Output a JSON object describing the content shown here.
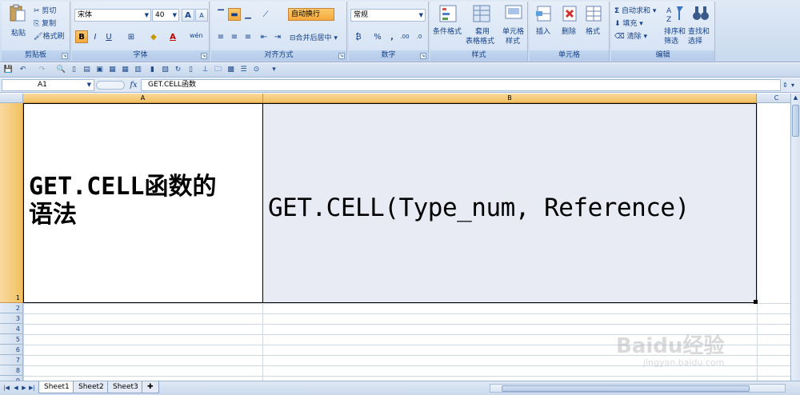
{
  "ribbon": {
    "clipboard": {
      "title": "剪贴板",
      "paste": "粘贴",
      "cut": "剪切",
      "copy": "复制",
      "format_painter": "格式刷"
    },
    "font": {
      "title": "字体",
      "font_name": "宋体",
      "font_size": "40",
      "bold": "B",
      "italic": "I",
      "underline": "U",
      "grow": "A",
      "shrink": "A",
      "phonetic": "wén"
    },
    "alignment": {
      "title": "对齐方式",
      "wrap_text": "自动换行",
      "merge_center": "合并后居中"
    },
    "number": {
      "title": "数字",
      "format": "常规",
      "percent": "%",
      "comma": ",",
      "inc_decimal": ".00",
      "dec_decimal": ".0"
    },
    "styles": {
      "title": "样式",
      "conditional": "条件格式",
      "table_format_1": "套用",
      "table_format_2": "表格格式",
      "cell_styles_1": "单元格",
      "cell_styles_2": "样式"
    },
    "cells": {
      "title": "单元格",
      "insert": "插入",
      "delete": "删除",
      "format": "格式"
    },
    "editing": {
      "title": "编辑",
      "autosum": "自动求和",
      "fill": "填充",
      "clear": "清除",
      "sort_1": "排序和",
      "sort_2": "筛选",
      "find_1": "查找和",
      "find_2": "选择"
    }
  },
  "formula_bar": {
    "name_box": "A1",
    "fx": "fx",
    "formula": "GET.CELL函数"
  },
  "columns": [
    "A",
    "B",
    "C"
  ],
  "rows": [
    "1",
    "2",
    "3",
    "4",
    "5",
    "6",
    "7",
    "8",
    "9"
  ],
  "cells": {
    "A1": "GET.CELL函数的语法",
    "B1": "GET.CELL(Type_num, Reference)"
  },
  "sheets": [
    "Sheet1",
    "Sheet2",
    "Sheet3"
  ],
  "watermark": {
    "brand": "Baidu经验",
    "url": "jingyan.baidu.com"
  },
  "colors": {
    "selected_header": "#f1c15f",
    "b1_fill": "#e8eaf4",
    "ribbon": "#d4e2f4"
  }
}
